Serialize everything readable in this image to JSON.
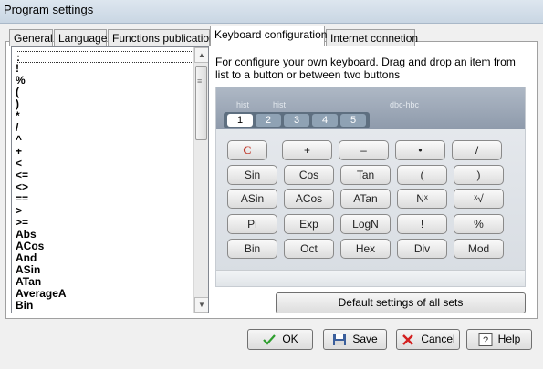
{
  "window": {
    "title": "Program settings"
  },
  "tabs": [
    {
      "label": "General"
    },
    {
      "label": "Language"
    },
    {
      "label": "Functions publication"
    },
    {
      "label": "Keyboard configuration"
    },
    {
      "label": "Internet connetion"
    }
  ],
  "function_list": {
    "items": [
      ":",
      "!",
      "%",
      "(",
      ")",
      "*",
      "/",
      "^",
      "+",
      "<",
      "<=",
      "<>",
      "==",
      ">",
      ">=",
      "Abs",
      "ACos",
      "And",
      "ASin",
      "ATan",
      "AverageA",
      "Bin"
    ],
    "selected_index": 0
  },
  "hint": {
    "text": "For configure your own keyboard. Drag and drop an item from list to a button or between two buttons"
  },
  "calculator": {
    "menu": [
      "hist",
      "hist",
      "dbc-hbc"
    ],
    "sets": [
      "1",
      "2",
      "3",
      "4",
      "5"
    ],
    "active_set": "1",
    "clear_label": "C",
    "rows": [
      [
        "+",
        "–",
        "•",
        "/"
      ],
      [
        "Sin",
        "Cos",
        "Tan",
        "(",
        ")"
      ],
      [
        "ASin",
        "ACos",
        "ATan",
        "Nˣ",
        "ˣ√"
      ],
      [
        "Pi",
        "Exp",
        "LogN",
        "!",
        "%"
      ],
      [
        "Bin",
        "Oct",
        "Hex",
        "Div",
        "Mod"
      ]
    ]
  },
  "buttons": {
    "default_sets": "Default settings of all sets",
    "ok": "OK",
    "save": "Save",
    "cancel": "Cancel",
    "help": "Help"
  },
  "colors": {
    "accent": "#5e6f80",
    "clear_red": "#c0392b",
    "ok_green": "#2e9e2e",
    "cancel_red": "#d32020"
  }
}
